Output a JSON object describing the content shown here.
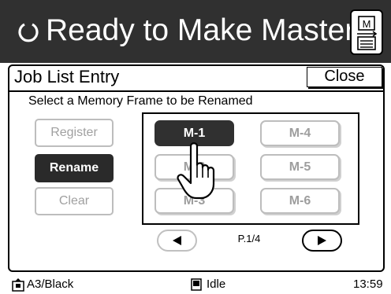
{
  "header": {
    "status_title": "Ready to Make Master",
    "doc_button_letter": "M"
  },
  "panel": {
    "title": "Job List Entry",
    "close_label": "Close",
    "instruction": "Select a Memory Frame to be Renamed"
  },
  "actions": [
    {
      "label": "Register",
      "state": "disabled"
    },
    {
      "label": "Rename",
      "state": "selected"
    },
    {
      "label": "Clear",
      "state": "disabled"
    }
  ],
  "memory_frames": [
    {
      "label": "M-1",
      "state": "selected"
    },
    {
      "label": "M-2",
      "state": "normal"
    },
    {
      "label": "M-3",
      "state": "normal"
    },
    {
      "label": "M-4",
      "state": "normal"
    },
    {
      "label": "M-5",
      "state": "normal"
    },
    {
      "label": "M-6",
      "state": "normal"
    }
  ],
  "pager": {
    "page_label": "P.1/4",
    "prev_enabled": false,
    "next_enabled": true
  },
  "status_bar": {
    "paper": "A3/Black",
    "state": "Idle",
    "time": "13:59"
  },
  "colors": {
    "header_bg": "#303030",
    "active_bg": "#2a2a2a",
    "disabled_text": "#a0a0a0"
  }
}
